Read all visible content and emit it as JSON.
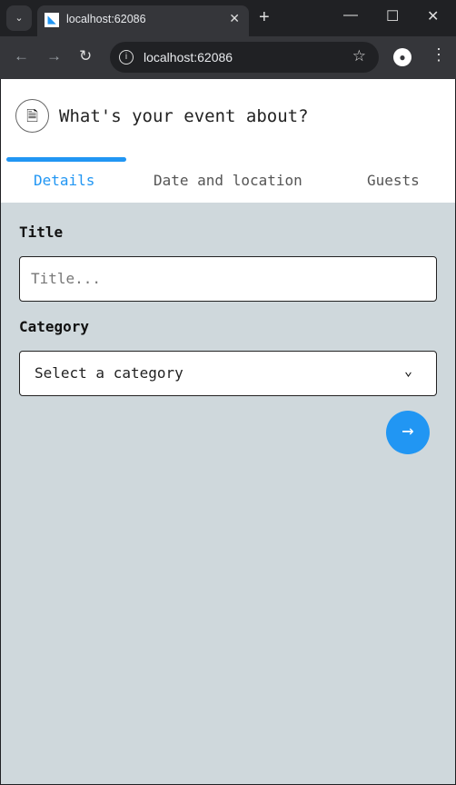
{
  "browser": {
    "tab_title": "localhost:62086",
    "url": "localhost:62086"
  },
  "header": {
    "title": "What's your event about?"
  },
  "tabs": [
    {
      "label": "Details"
    },
    {
      "label": "Date and location"
    },
    {
      "label": "Guests"
    }
  ],
  "form": {
    "title_label": "Title",
    "title_placeholder": "Title...",
    "category_label": "Category",
    "category_value": "Select a category"
  },
  "colors": {
    "accent": "#2196f3",
    "background": "#cfd8dc"
  }
}
